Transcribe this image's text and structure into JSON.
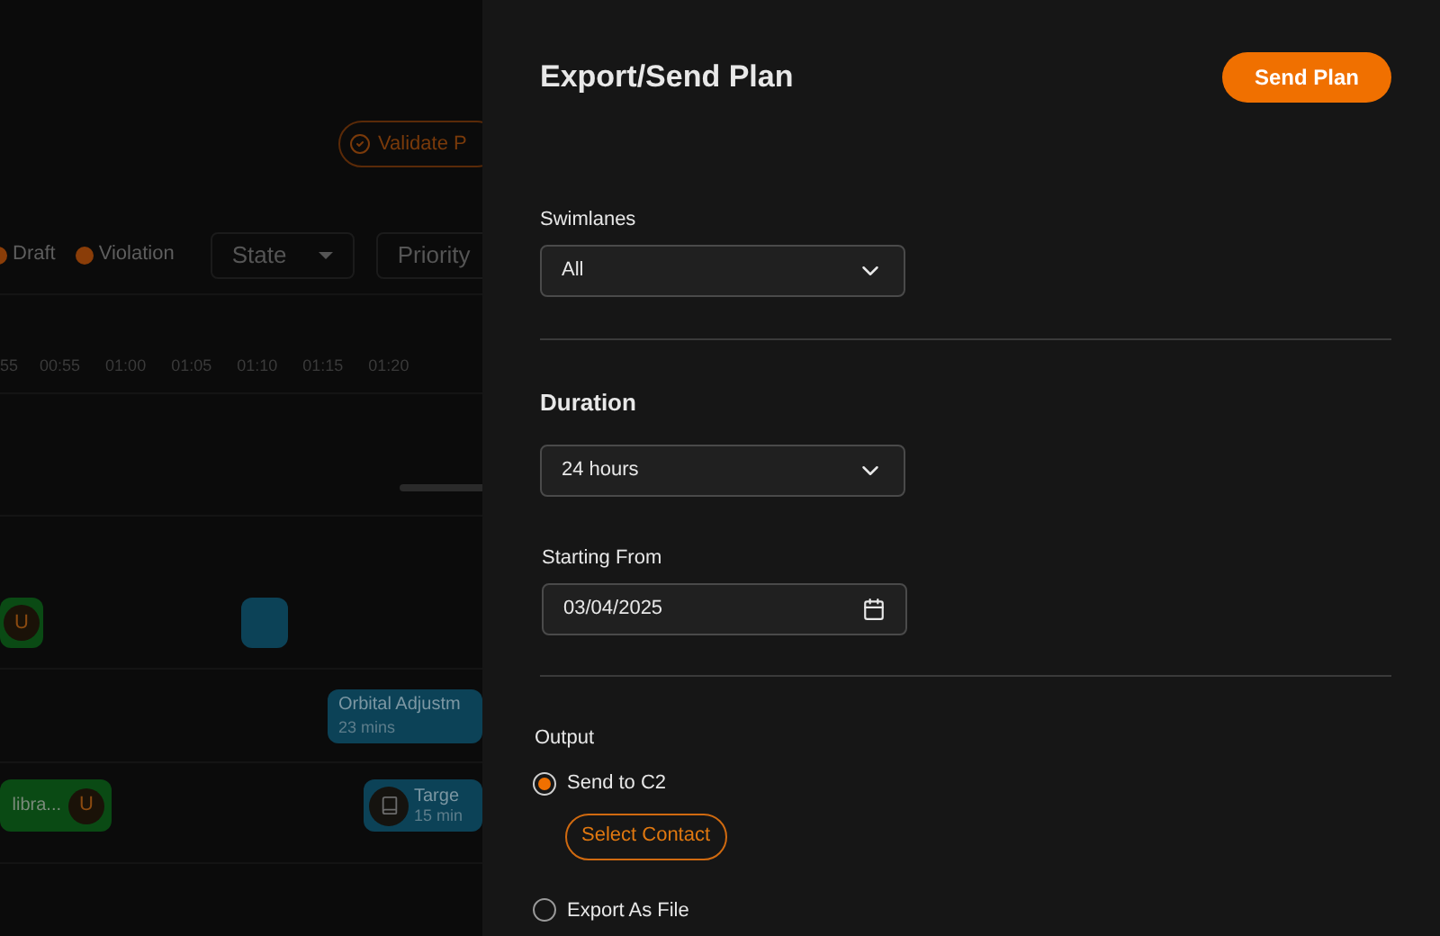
{
  "background": {
    "validate_button": "Validate P",
    "legend": [
      {
        "label": "Draft",
        "color": "#8a3d08"
      },
      {
        "label": "Violation",
        "color": "#8a3d08"
      }
    ],
    "filters": [
      "State",
      "Priority"
    ],
    "time_ticks": [
      "55",
      "00:55",
      "01:00",
      "01:05",
      "01:10",
      "01:15",
      "01:20"
    ],
    "lanes": [
      {
        "events": [
          {
            "kind": "badge",
            "badge": "U",
            "color": "#0a4a14"
          },
          {
            "kind": "block",
            "color": "#0c4257"
          }
        ]
      },
      {
        "events": [
          {
            "kind": "task",
            "label": "Orbital Adjustm",
            "duration": "23 mins",
            "color": "#0c4257"
          }
        ]
      },
      {
        "events": [
          {
            "kind": "badge-task",
            "label": "libra...",
            "badge": "U",
            "color": "#0a4a14"
          },
          {
            "kind": "icon-task",
            "label": "Targe",
            "duration": "15 min",
            "color": "#0c4257"
          }
        ]
      }
    ]
  },
  "drawer": {
    "title": "Export/Send Plan",
    "send_button": "Send Plan",
    "swimlanes": {
      "label": "Swimlanes",
      "value": "All"
    },
    "duration": {
      "heading": "Duration",
      "value": "24 hours"
    },
    "starting_from": {
      "label": "Starting From",
      "value": "03/04/2025"
    },
    "output": {
      "label": "Output",
      "options": [
        {
          "label": "Send to C2",
          "selected": true
        },
        {
          "label": "Export As File",
          "selected": false
        }
      ],
      "select_contact": "Select Contact"
    }
  }
}
